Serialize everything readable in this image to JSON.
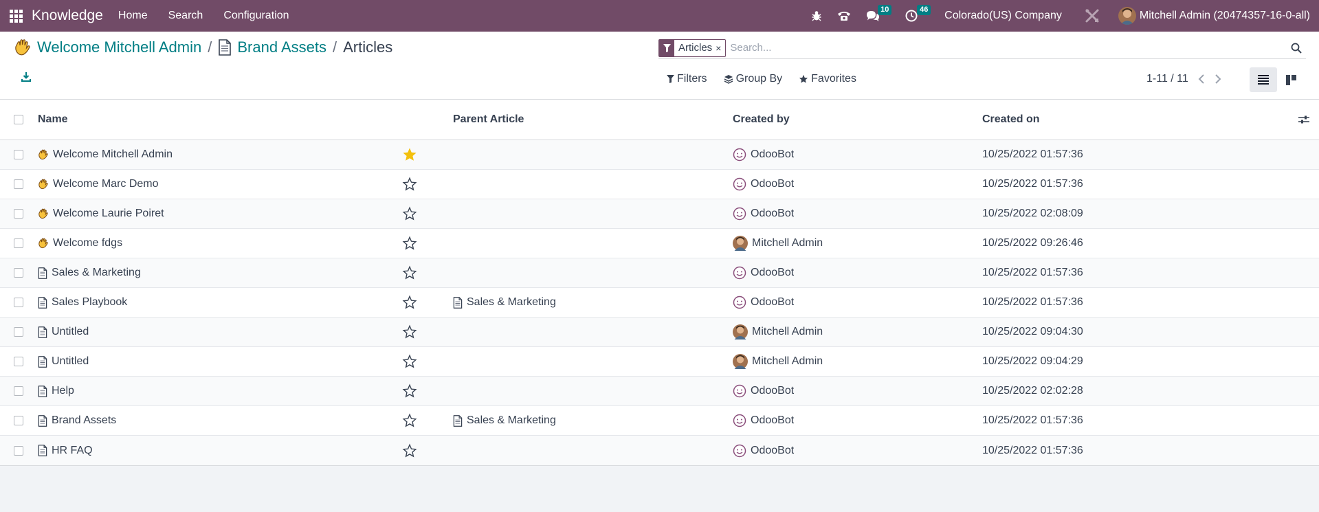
{
  "navbar": {
    "app_name": "Knowledge",
    "menu": [
      "Home",
      "Search",
      "Configuration"
    ],
    "messages_count": "10",
    "activities_count": "46",
    "company": "Colorado(US) Company",
    "user": "Mitchell Admin (20474357-16-0-all)"
  },
  "breadcrumb": {
    "root": "Welcome Mitchell Admin",
    "root_emoji": "👋",
    "parent": "Brand Assets",
    "current": "Articles"
  },
  "search": {
    "facet": "Articles",
    "facet_remove": "×",
    "placeholder": "Search..."
  },
  "toolbar": {
    "filters": "Filters",
    "group_by": "Group By",
    "favorites": "Favorites",
    "pager": "1-11 / 11"
  },
  "columns": {
    "name": "Name",
    "parent": "Parent Article",
    "created_by": "Created by",
    "created_on": "Created on"
  },
  "rows": [
    {
      "icon": "wave",
      "name": "Welcome Mitchell Admin",
      "favorite": true,
      "parent": "",
      "created_by": "OdooBot",
      "creator_avatar": "odoobot",
      "created_on": "10/25/2022 01:57:36"
    },
    {
      "icon": "wave",
      "name": "Welcome Marc Demo",
      "favorite": false,
      "parent": "",
      "created_by": "OdooBot",
      "creator_avatar": "odoobot",
      "created_on": "10/25/2022 01:57:36"
    },
    {
      "icon": "wave",
      "name": "Welcome Laurie Poiret",
      "favorite": false,
      "parent": "",
      "created_by": "OdooBot",
      "creator_avatar": "odoobot",
      "created_on": "10/25/2022 02:08:09"
    },
    {
      "icon": "wave",
      "name": "Welcome fdgs",
      "favorite": false,
      "parent": "",
      "created_by": "Mitchell Admin",
      "creator_avatar": "admin",
      "created_on": "10/25/2022 09:26:46"
    },
    {
      "icon": "page",
      "name": "Sales & Marketing",
      "favorite": false,
      "parent": "",
      "created_by": "OdooBot",
      "creator_avatar": "odoobot",
      "created_on": "10/25/2022 01:57:36"
    },
    {
      "icon": "page",
      "name": "Sales Playbook",
      "favorite": false,
      "parent": "Sales & Marketing",
      "created_by": "OdooBot",
      "creator_avatar": "odoobot",
      "created_on": "10/25/2022 01:57:36"
    },
    {
      "icon": "page",
      "name": "Untitled",
      "favorite": false,
      "parent": "",
      "created_by": "Mitchell Admin",
      "creator_avatar": "admin",
      "created_on": "10/25/2022 09:04:30"
    },
    {
      "icon": "page",
      "name": "Untitled",
      "favorite": false,
      "parent": "",
      "created_by": "Mitchell Admin",
      "creator_avatar": "admin",
      "created_on": "10/25/2022 09:04:29"
    },
    {
      "icon": "page",
      "name": "Help",
      "favorite": false,
      "parent": "",
      "created_by": "OdooBot",
      "creator_avatar": "odoobot",
      "created_on": "10/25/2022 02:02:28"
    },
    {
      "icon": "page",
      "name": "Brand Assets",
      "favorite": false,
      "parent": "Sales & Marketing",
      "created_by": "OdooBot",
      "creator_avatar": "odoobot",
      "created_on": "10/25/2022 01:57:36"
    },
    {
      "icon": "page",
      "name": "HR FAQ",
      "favorite": false,
      "parent": "",
      "created_by": "OdooBot",
      "creator_avatar": "odoobot",
      "created_on": "10/25/2022 01:57:36"
    }
  ],
  "colors": {
    "brand": "#714b67",
    "link": "#017e84",
    "badge": "#017e84",
    "star": "#f3c00c"
  }
}
